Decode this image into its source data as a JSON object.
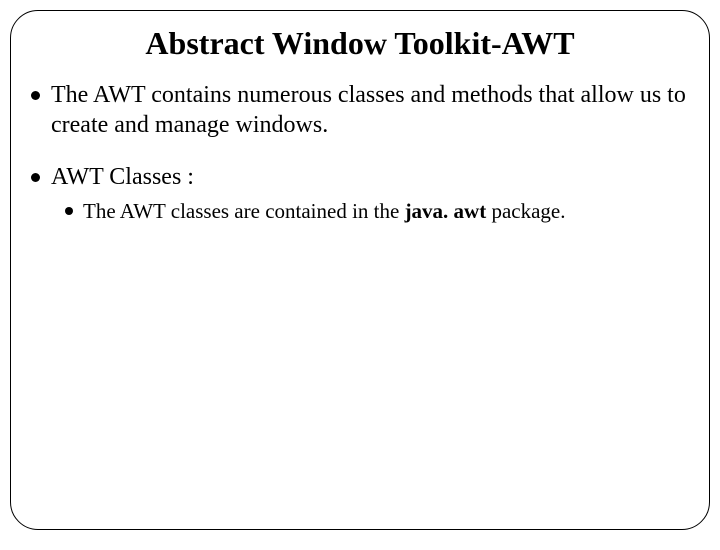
{
  "title": "Abstract Window Toolkit-AWT",
  "bullets": {
    "b1": "The AWT contains numerous classes and methods that allow us to create and manage windows.",
    "b2": "AWT Classes :",
    "sub1_prefix": "The AWT classes are contained in the ",
    "sub1_bold": "java. awt ",
    "sub1_suffix": "package."
  }
}
